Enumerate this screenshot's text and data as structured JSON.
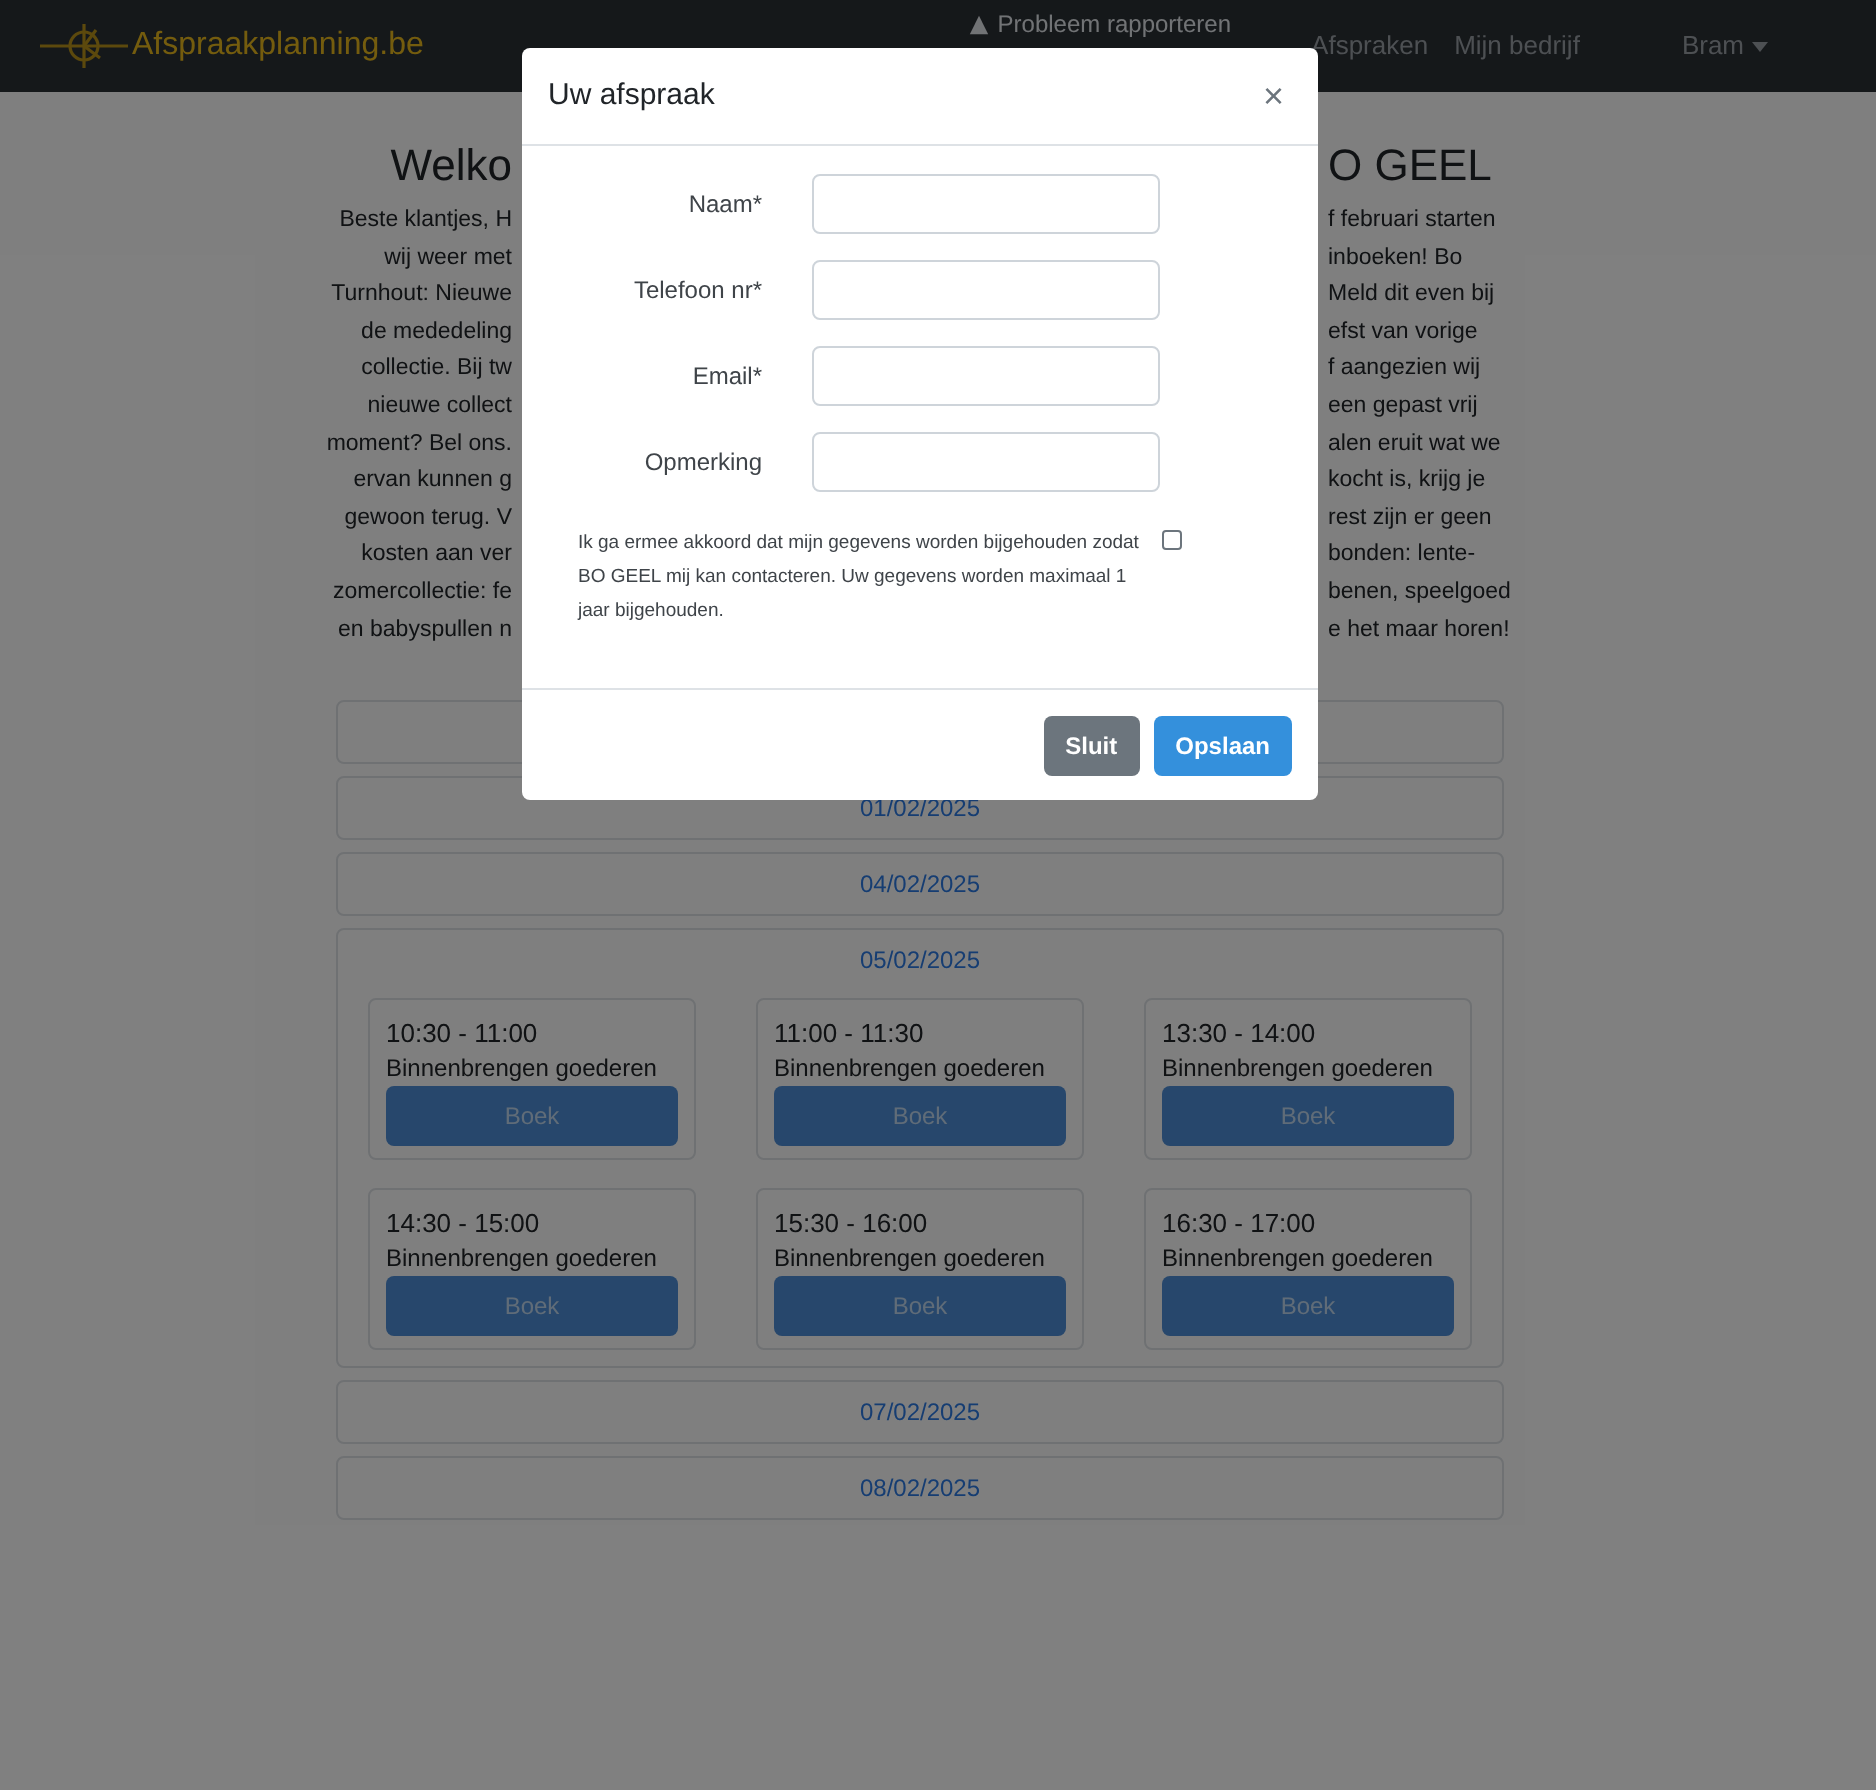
{
  "navbar": {
    "brand": "Afspraakplanning.be",
    "links": [
      {
        "kind": "report",
        "label": "Probleem rapporteren"
      },
      {
        "kind": "link",
        "label": "Afspraken"
      },
      {
        "kind": "link",
        "label": "Mijn bedrijf"
      },
      {
        "kind": "dropdown",
        "label": "Bram"
      }
    ]
  },
  "page": {
    "heading_left": "Welko",
    "heading_right": "O GEEL",
    "intro_lines": [
      {
        "left": "Beste klantjes, H",
        "right": "f februari starten"
      },
      {
        "left": "wij weer met",
        "right": "inboeken! Bo"
      },
      {
        "left": "Turnhout: Nieuwe",
        "right": "Meld dit even bij"
      },
      {
        "left": "de mededeling",
        "right": "efst van vorige"
      },
      {
        "left": "collectie. Bij tw",
        "right": "f aangezien wij"
      },
      {
        "left": "nieuwe collect",
        "right": "een gepast vrij"
      },
      {
        "left": "moment? Bel ons.",
        "right": "alen eruit wat we"
      },
      {
        "left": "ervan kunnen g",
        "right": "kocht is, krijg je"
      },
      {
        "left": "gewoon terug. V",
        "right": "rest zijn er geen"
      },
      {
        "left": "kosten aan ver",
        "right": "bonden: lente-"
      },
      {
        "left": "zomercollectie: fe",
        "right": "benen, speelgoed"
      },
      {
        "left": "en babyspullen n",
        "right": "e het maar horen!"
      }
    ],
    "days": [
      {
        "kind": "covered"
      },
      {
        "kind": "date",
        "date": "01/02/2025",
        "expanded": false
      },
      {
        "kind": "date",
        "date": "04/02/2025",
        "expanded": false
      },
      {
        "kind": "date",
        "date": "05/02/2025",
        "expanded": true,
        "slots": [
          {
            "time": "10:30 - 11:00",
            "type": "Binnenbrengen goederen",
            "button": "Boek"
          },
          {
            "time": "11:00 - 11:30",
            "type": "Binnenbrengen goederen",
            "button": "Boek"
          },
          {
            "time": "13:30 - 14:00",
            "type": "Binnenbrengen goederen",
            "button": "Boek"
          },
          {
            "time": "14:30 - 15:00",
            "type": "Binnenbrengen goederen",
            "button": "Boek"
          },
          {
            "time": "15:30 - 16:00",
            "type": "Binnenbrengen goederen",
            "button": "Boek"
          },
          {
            "time": "16:30 - 17:00",
            "type": "Binnenbrengen goederen",
            "button": "Boek"
          }
        ]
      },
      {
        "kind": "date",
        "date": "07/02/2025",
        "expanded": false
      },
      {
        "kind": "date",
        "date": "08/02/2025",
        "expanded": false
      }
    ]
  },
  "modal": {
    "title": "Uw afspraak",
    "close": "×",
    "fields": [
      {
        "label": "Naam*"
      },
      {
        "label": "Telefoon nr*"
      },
      {
        "label": "Email*"
      },
      {
        "label": "Opmerking"
      }
    ],
    "consent": {
      "text": "Ik ga ermee akkoord dat mijn gegevens worden bijgehouden zodat BO GEEL mij kan contacteren. Uw gegevens worden maximaal 1 jaar bijgehouden.",
      "checked": false
    },
    "buttons": [
      {
        "kind": "secondary",
        "label": "Sluit"
      },
      {
        "kind": "primary",
        "label": "Opslaan"
      }
    ]
  }
}
